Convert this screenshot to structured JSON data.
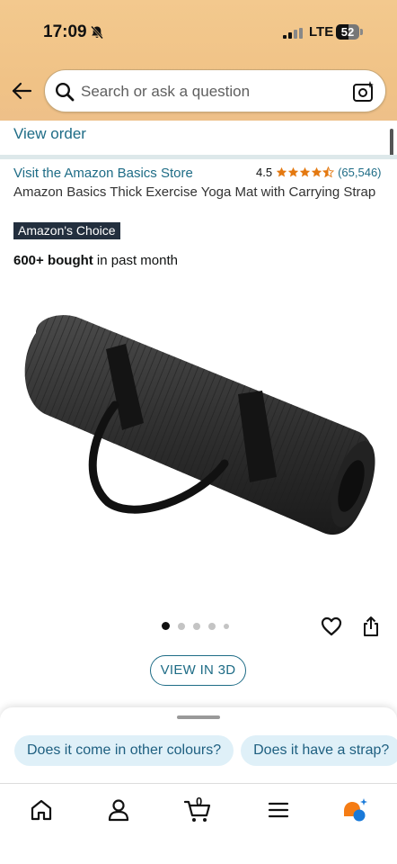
{
  "status_bar": {
    "time": "17:09",
    "network": "LTE",
    "battery_level": "52",
    "battery_fraction": 0.52
  },
  "search": {
    "placeholder": "Search or ask a question"
  },
  "order": {
    "view_order_label": "View order"
  },
  "product": {
    "store_link": "Visit the Amazon Basics Store",
    "rating_value": "4.5",
    "rating_stars": 4.5,
    "rating_count": "(65,546)",
    "title": "Amazon Basics Thick Exercise Yoga Mat with Carrying Strap",
    "badge": "Amazon's Choice",
    "bought_bold": "600+ bought",
    "bought_rest": " in past month",
    "image_icon": "black-rolled-yoga-mat-with-strap",
    "image_count": 5,
    "active_image": 1
  },
  "actions": {
    "view_3d_label": "VIEW IN 3D",
    "wishlist_icon": "heart-icon",
    "share_icon": "share-icon"
  },
  "suggestions": [
    "Does it come in other colours?",
    "Does it have a strap?"
  ],
  "bottom_nav": {
    "items": [
      "home-icon",
      "account-icon",
      "cart-icon",
      "menu-icon",
      "rufus-icon"
    ],
    "cart_count": "0"
  },
  "colors": {
    "header_bg": "#f0c286",
    "link": "#1e6c86",
    "badge_bg": "#232f3e",
    "star": "#e47911",
    "chip_bg": "#dff0f8"
  }
}
